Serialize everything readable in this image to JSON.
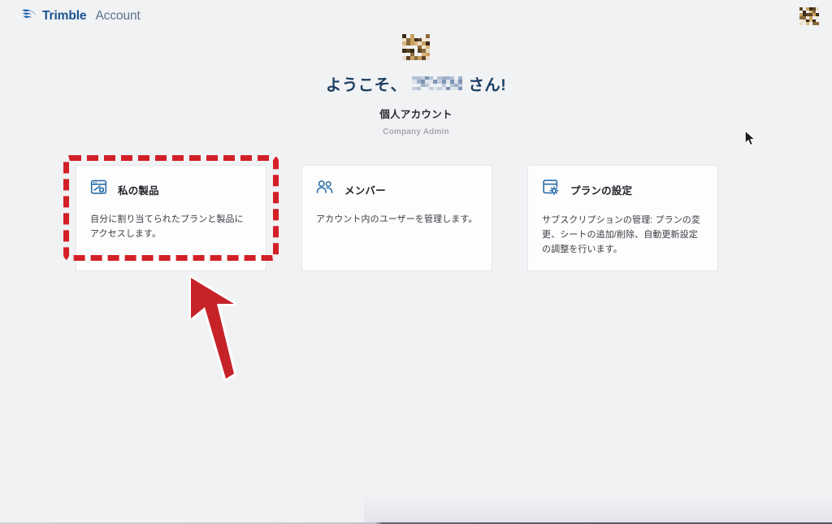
{
  "header": {
    "brand_name": "Trimble",
    "brand_sub": "Account",
    "logo_icon": "trimble-logo-icon",
    "avatar_icon": "user-avatar-redacted"
  },
  "hero": {
    "avatar_icon": "profile-avatar-redacted",
    "welcome_prefix": "ようこそ、",
    "welcome_suffix": " さん!",
    "redacted_name": "",
    "account_type": "個人アカウント",
    "account_role": "Company Admin"
  },
  "cards": [
    {
      "icon": "my-products-icon",
      "title": "私の製品",
      "description": "自分に割り当てられたプランと製品にアクセスします。"
    },
    {
      "icon": "members-people-icon",
      "title": "メンバー",
      "description": "アカウント内のユーザーを管理します。"
    },
    {
      "icon": "plan-settings-gear-icon",
      "title": "プランの設定",
      "description": "サブスクリプションの管理: プランの変更、シートの追加/削除、自動更新設定の調整を行います。"
    }
  ],
  "annotations": {
    "highlight_target": "私の製品",
    "highlight_color": "#d32027",
    "arrow_color": "#c62329",
    "arrow_icon": "annotation-arrow-icon",
    "cursor_icon": "mouse-cursor-icon"
  },
  "colors": {
    "background": "#f1f2f4",
    "card_background": "#fdfdfd",
    "card_border": "#e6e6ea",
    "brand_blue": "#195391",
    "brand_gray": "#5b738c",
    "icon_blue": "#2c6ea8",
    "heading_navy": "#1b3d63",
    "muted_text": "#a8a8b0"
  }
}
